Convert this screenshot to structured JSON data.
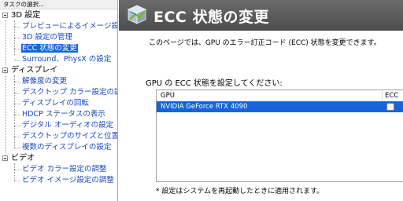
{
  "nav": {
    "header": "タスクの選択...",
    "categories": [
      {
        "label": "3D 設定",
        "items": [
          {
            "label": "プレビューによるイメージ設定の調整"
          },
          {
            "label": "3D 設定の管理"
          },
          {
            "label": "ECC 状態の変更",
            "selected": true
          },
          {
            "label": "Surround、PhysX の設定"
          }
        ]
      },
      {
        "label": "ディスプレイ",
        "items": [
          {
            "label": "解像度の変更"
          },
          {
            "label": "デスクトップ カラー設定の調整"
          },
          {
            "label": "ディスプレイの回転"
          },
          {
            "label": "HDCP ステータスの表示"
          },
          {
            "label": "デジタル オーディオの設定"
          },
          {
            "label": "デスクトップのサイズと位置の調整"
          },
          {
            "label": "複数のディスプレイの設定"
          }
        ]
      },
      {
        "label": "ビデオ",
        "items": [
          {
            "label": "ビデオ カラー設定の調整"
          },
          {
            "label": "ビデオ イメージ設定の調整"
          }
        ]
      }
    ]
  },
  "page": {
    "title": "ECC 状態の変更",
    "description": "このページでは、GPU のエラー訂正コード (ECC) 状態を変更できます。",
    "section_title": "GPU の ECC 状態を設定してください:",
    "table": {
      "columns": [
        "GPU",
        "ECC"
      ],
      "rows": [
        {
          "gpu": "NVIDIA GeForce RTX 4090",
          "ecc": false
        }
      ]
    },
    "footnote": "* 設定はシステムを再起動したときに適用されます。"
  },
  "colors": {
    "banner": "#5a5a5a",
    "selection": "#1565d8",
    "link": "#1a47c4",
    "nvidia_green": "#76b900"
  },
  "icons": {
    "banner": "nvidia-3d-cube-icon"
  }
}
